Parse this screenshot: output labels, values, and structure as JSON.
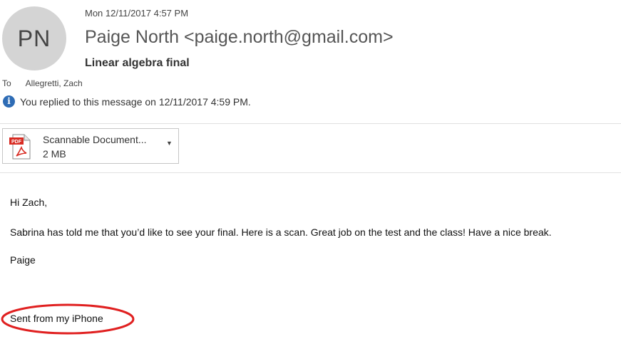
{
  "sender": {
    "avatar_initials": "PN",
    "display": "Paige North <paige.north@gmail.com>"
  },
  "message": {
    "date": "Mon 12/11/2017 4:57 PM",
    "subject": "Linear algebra final",
    "to_label": "To",
    "to_value": "Allegretti, Zach",
    "reply_notice": "You replied to this message on 12/11/2017 4:59 PM."
  },
  "attachment": {
    "name": "Scannable Document...",
    "size": "2 MB",
    "type_badge": "PDF"
  },
  "body": {
    "greeting": "Hi Zach,",
    "paragraph": "Sabrina has told me that you’d like to see your final. Here is a scan. Great job on the test and the class! Have a nice break.",
    "signature": "Paige",
    "footer": "Sent from my iPhone"
  },
  "colors": {
    "avatar_bg": "#d4d4d4",
    "info_icon": "#2e6cb5",
    "annotation_circle": "#e02020",
    "pdf_red": "#d82b22"
  },
  "icons": {
    "info": "info-icon",
    "attachment": "pdf-file-icon",
    "dropdown": "chevron-down-icon"
  }
}
